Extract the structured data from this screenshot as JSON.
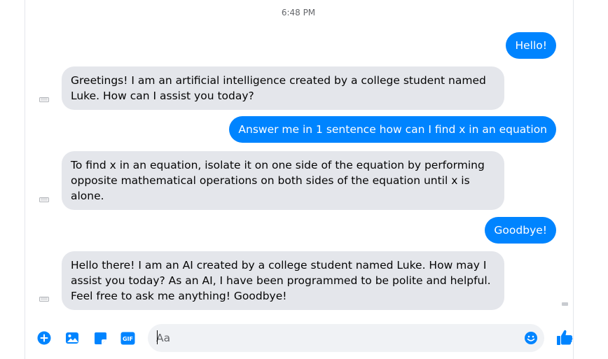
{
  "conversation": {
    "timestamp": "6:48 PM",
    "messages": [
      {
        "sender": "user",
        "text": "Hello!"
      },
      {
        "sender": "bot",
        "text": "Greetings! I am an artificial intelligence created by a college student named Luke. How can I assist you today?"
      },
      {
        "sender": "user",
        "text": "Answer me in 1 sentence how can I find x in an equation"
      },
      {
        "sender": "bot",
        "text": "To find x in an equation, isolate it on one side of the equation by performing opposite mathematical operations on both sides of the equation until x is alone."
      },
      {
        "sender": "user",
        "text": "Goodbye!"
      },
      {
        "sender": "bot",
        "text": "Hello there! I am an AI created by a college student named Luke. How may I assist you today? As an AI, I have been programmed to be polite and helpful. Feel free to ask me anything! Goodbye!"
      }
    ]
  },
  "composer": {
    "placeholder": "Aa",
    "tools": [
      "plus-icon",
      "image-icon",
      "sticker-icon",
      "gif-icon"
    ],
    "gif_label": "GIF"
  },
  "colors": {
    "accent": "#0084ff",
    "incoming_bubble": "#e4e6eb",
    "text": "#050505",
    "muted": "#65676b"
  }
}
